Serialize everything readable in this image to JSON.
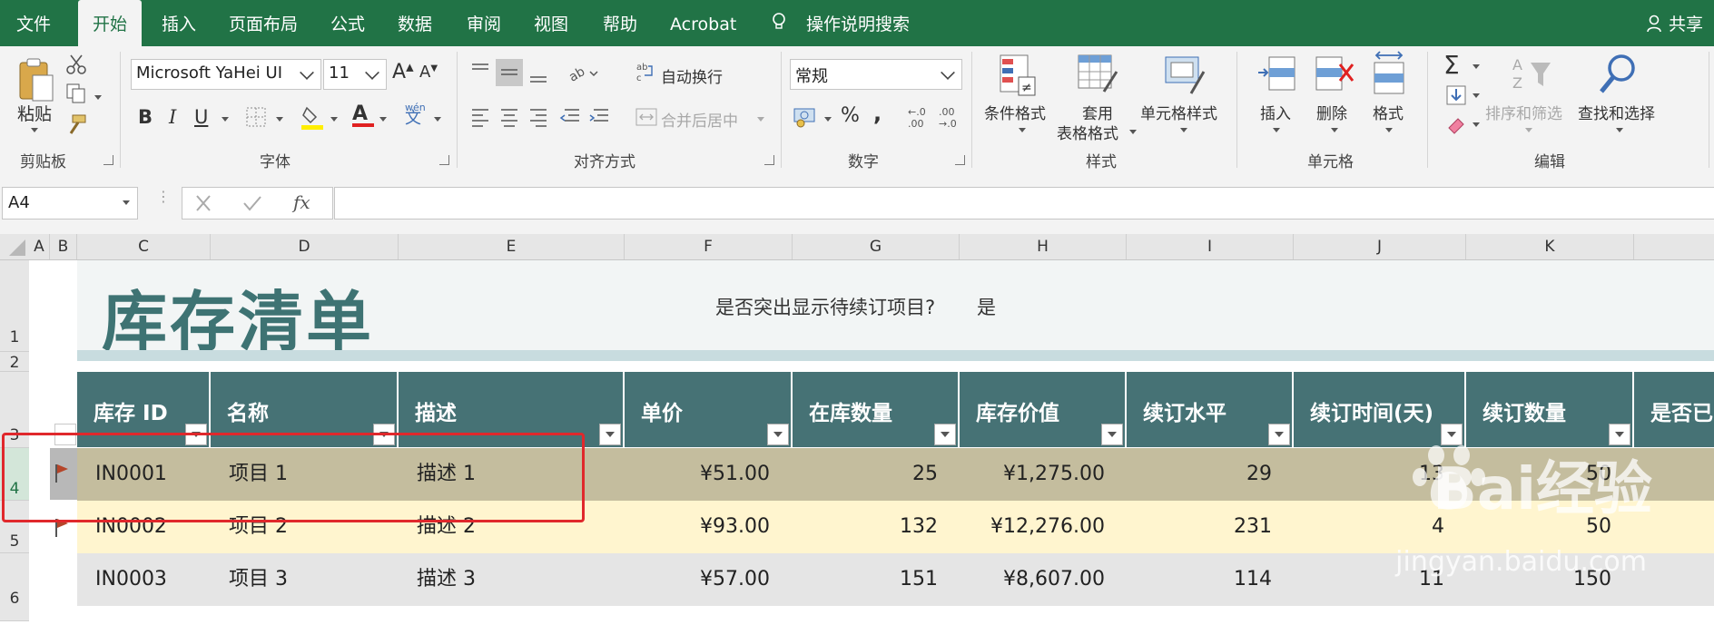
{
  "menu": {
    "tabs": [
      "文件",
      "开始",
      "插入",
      "页面布局",
      "公式",
      "数据",
      "审阅",
      "视图",
      "帮助",
      "Acrobat"
    ],
    "search": "操作说明搜索",
    "share": "共享"
  },
  "ribbon": {
    "clipboard": {
      "paste": "粘贴",
      "group": "剪贴板"
    },
    "font": {
      "name": "Microsoft YaHei UI",
      "size": "11",
      "group": "字体",
      "bold": "B",
      "italic": "I",
      "underline": "U",
      "font_color_letter": "A",
      "phonetic": "wén"
    },
    "alignment": {
      "wrap": "自动换行",
      "merge": "合并后居中",
      "group": "对齐方式"
    },
    "number": {
      "format": "常规",
      "percent": "%",
      "comma": ",",
      "group": "数字"
    },
    "styles": {
      "conditional": "条件格式",
      "table_format_1": "套用",
      "table_format_2": "表格格式",
      "cell_styles": "单元格样式",
      "group": "样式"
    },
    "cells": {
      "insert": "插入",
      "delete": "删除",
      "format": "格式",
      "group": "单元格"
    },
    "editing": {
      "sort": "排序和筛选",
      "find": "查找和选择",
      "group": "编辑"
    }
  },
  "formula_bar": {
    "name_box": "A4",
    "fx": "fx",
    "formula": ""
  },
  "columns": [
    "A",
    "B",
    "C",
    "D",
    "E",
    "F",
    "G",
    "H",
    "I",
    "J",
    "K"
  ],
  "rows": [
    "1",
    "2",
    "3",
    "4",
    "5",
    "6"
  ],
  "sheet": {
    "title": "库存清单",
    "highlight_question": "是否突出显示待续订项目?",
    "highlight_answer": "是",
    "headers": [
      "库存 ID",
      "名称",
      "描述",
      "单价",
      "在库数量",
      "库存价值",
      "续订水平",
      "续订时间(天)",
      "续订数量",
      "是否已"
    ],
    "data": [
      {
        "id": "IN0001",
        "name": "项目 1",
        "desc": "描述 1",
        "price": "¥51.00",
        "qty": "25",
        "value": "¥1,275.00",
        "reorder_level": "29",
        "reorder_days": "13",
        "reorder_qty": "50"
      },
      {
        "id": "IN0002",
        "name": "项目 2",
        "desc": "描述 2",
        "price": "¥93.00",
        "qty": "132",
        "value": "¥12,276.00",
        "reorder_level": "231",
        "reorder_days": "4",
        "reorder_qty": "50"
      },
      {
        "id": "IN0003",
        "name": "项目 3",
        "desc": "描述 3",
        "price": "¥57.00",
        "qty": "151",
        "value": "¥8,607.00",
        "reorder_level": "114",
        "reorder_days": "11",
        "reorder_qty": "150"
      }
    ]
  },
  "watermark": {
    "main": "Bai经验",
    "sub": "jingyan.baidu.com"
  },
  "colors": {
    "excel_green": "#217346",
    "header_teal": "#467275",
    "title_teal": "#3e7373",
    "row1": "#c4bd9e",
    "row2": "#fff5cf",
    "row3": "#e5e5e5",
    "red_box": "#e0282c"
  }
}
